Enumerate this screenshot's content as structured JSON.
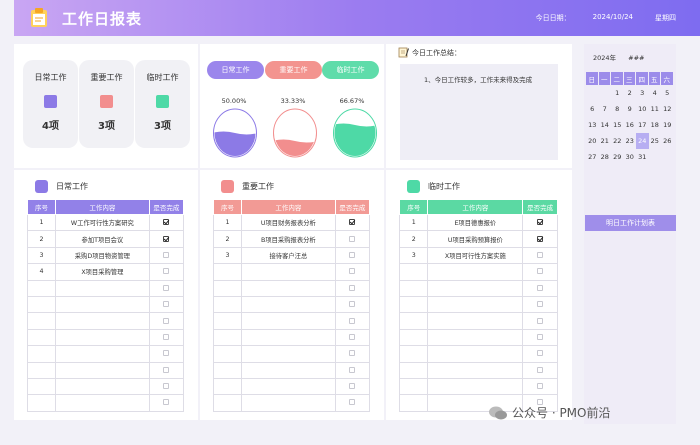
{
  "header": {
    "title": "工作日报表",
    "date_label": "今日日期：",
    "date_value": "2024/10/24",
    "weekday": "星期四"
  },
  "kpis": [
    {
      "label": "日常工作",
      "value": "4项",
      "color": "#8c7ae6"
    },
    {
      "label": "重要工作",
      "value": "3项",
      "color": "#f28e8e"
    },
    {
      "label": "临时工作",
      "value": "3项",
      "color": "#4ed9a6"
    }
  ],
  "progress": [
    {
      "label": "日常工作",
      "percent": "50.00%",
      "fraction": 0.5,
      "color": "#8c7ae6"
    },
    {
      "label": "重要工作",
      "percent": "33.33%",
      "fraction": 0.3333,
      "color": "#f28e8e"
    },
    {
      "label": "临时工作",
      "percent": "66.67%",
      "fraction": 0.6667,
      "color": "#4ed9a6"
    }
  ],
  "summary": {
    "title": "今日工作总结：",
    "text": "1、今日工作较多，工作未来得及完成"
  },
  "calendar": {
    "year": "2024年",
    "month": "###",
    "weekdays": [
      "日",
      "一",
      "二",
      "三",
      "四",
      "五",
      "六"
    ],
    "days": [
      "",
      "",
      "1",
      "2",
      "3",
      "4",
      "5",
      "6",
      "7",
      "8",
      "9",
      "10",
      "11",
      "12",
      "13",
      "14",
      "15",
      "16",
      "17",
      "18",
      "19",
      "20",
      "21",
      "22",
      "23",
      "24",
      "25",
      "26",
      "27",
      "28",
      "29",
      "30",
      "31",
      "",
      ""
    ],
    "today": "24"
  },
  "plan_button": "明日工作计划表",
  "tables": [
    {
      "title": "日常工作",
      "color": "#9281e8",
      "headers": [
        "序号",
        "工作内容",
        "是否完成"
      ],
      "rows": [
        {
          "no": "1",
          "content": "W工作可行性方案研究",
          "done": true
        },
        {
          "no": "2",
          "content": "参加T项目会议",
          "done": true
        },
        {
          "no": "3",
          "content": "采购D项目物资管理",
          "done": false
        },
        {
          "no": "4",
          "content": "X项目采购管理",
          "done": false
        }
      ]
    },
    {
      "title": "重要工作",
      "color": "#f29a95",
      "headers": [
        "序号",
        "工作内容",
        "是否完成"
      ],
      "rows": [
        {
          "no": "1",
          "content": "U项目财务报表分析",
          "done": true
        },
        {
          "no": "2",
          "content": "B项目采购报表分析",
          "done": false
        },
        {
          "no": "3",
          "content": "接待客户汪总",
          "done": false
        }
      ]
    },
    {
      "title": "临时工作",
      "color": "#5bd9a3",
      "headers": [
        "序号",
        "工作内容",
        "是否完成"
      ],
      "rows": [
        {
          "no": "1",
          "content": "E项目德惠报价",
          "done": true
        },
        {
          "no": "2",
          "content": "U项目采购预算报价",
          "done": true
        },
        {
          "no": "3",
          "content": "X项目可行性方案实施",
          "done": false
        }
      ]
    }
  ],
  "watermark": "公众号 · PMO前沿"
}
